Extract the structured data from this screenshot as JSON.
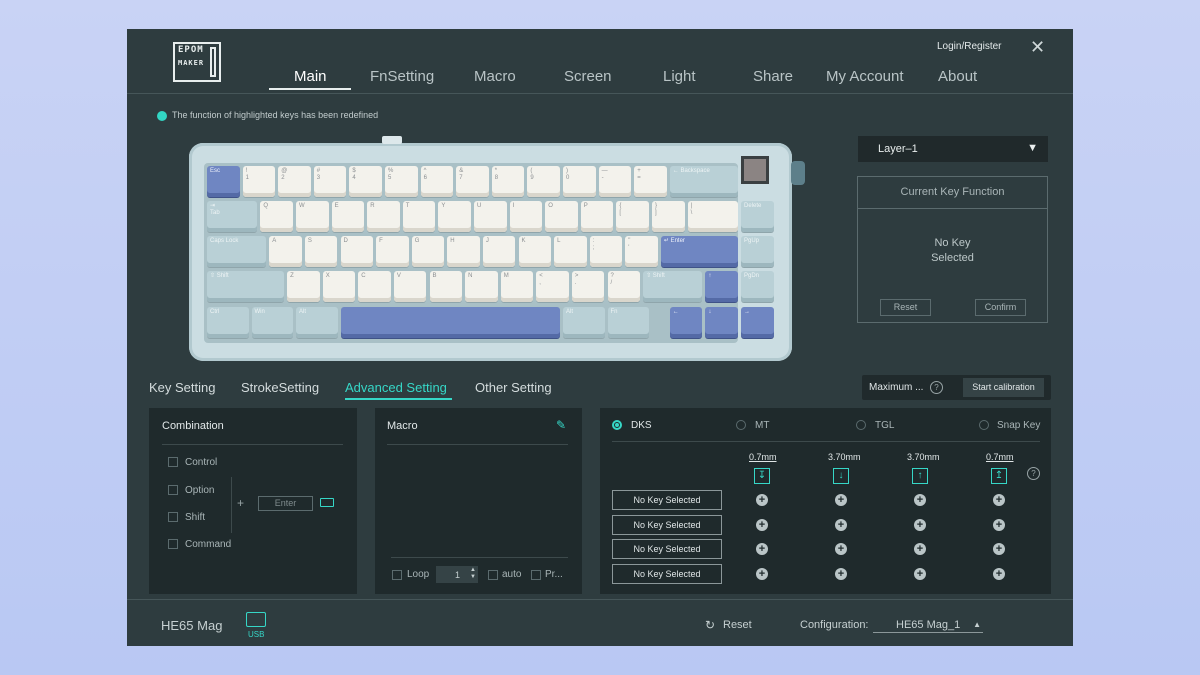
{
  "brand": {
    "line1": "EPOM",
    "line2": "MAKER"
  },
  "header": {
    "login": "Login/Register",
    "close": "✕"
  },
  "nav": [
    "Main",
    "FnSetting",
    "Macro",
    "Screen",
    "Light",
    "Share",
    "My Account",
    "About"
  ],
  "notice": "The function of highlighted keys has been redefined",
  "keyboard": {
    "row1": [
      "Esc",
      "!\n1",
      "@\n2",
      "#\n3",
      "$\n4",
      "%\n5",
      "^\n6",
      "&\n7",
      "*\n8",
      "(\n9",
      ")\n0",
      "—\n-",
      "+\n=",
      "← Backspace"
    ],
    "row2": [
      "⇥\nTab",
      "Q",
      "W",
      "E",
      "R",
      "T",
      "Y",
      "U",
      "I",
      "O",
      "P",
      "{\n[",
      "}\n]",
      "|\n\\",
      "Delete"
    ],
    "row3": [
      "Caps Lock",
      "A",
      "S",
      "D",
      "F",
      "G",
      "H",
      "J",
      "K",
      "L",
      ":\n;",
      "\"\n'",
      "↵ Enter",
      "PgUp"
    ],
    "row4": [
      "⇧ Shift",
      "Z",
      "X",
      "C",
      "V",
      "B",
      "N",
      "M",
      "<\n,",
      ">\n.",
      "?\n/",
      "⇧ Shift",
      "↑",
      "PgDn"
    ],
    "row5": [
      "Ctrl",
      "Win",
      "Alt",
      "",
      "Alt",
      "Fn",
      "←",
      "↓",
      "→"
    ]
  },
  "layer": {
    "label": "Layer–1",
    "arrow": "▼"
  },
  "key_function": {
    "title": "Current Key Function",
    "empty1": "No Key",
    "empty2": "Selected",
    "reset": "Reset",
    "confirm": "Confirm"
  },
  "tabs": [
    "Key Setting",
    "StrokeSetting",
    "Advanced Setting",
    "Other Setting"
  ],
  "calib": {
    "maximum": "Maximum ...",
    "help": "?",
    "start": "Start calibration"
  },
  "combination": {
    "title": "Combination",
    "options": [
      "Control",
      "Option",
      "Shift",
      "Command"
    ],
    "plus": "+",
    "key_placeholder": "Enter"
  },
  "macro": {
    "title": "Macro",
    "loop": "Loop",
    "loop_value": "1",
    "auto": "auto",
    "pr": "Pr..."
  },
  "dks": {
    "modes": [
      "DKS",
      "MT",
      "TGL",
      "Snap Key"
    ],
    "values": [
      "0.7mm",
      "3.70mm",
      "3.70mm",
      "0.7mm"
    ],
    "help": "?",
    "rows": [
      "No Key Selected",
      "No Key Selected",
      "No Key Selected",
      "No Key Selected"
    ]
  },
  "footer": {
    "device": "HE65 Mag",
    "usb": "USB",
    "reset": "Reset",
    "config_label": "Configuration:",
    "config_value": "HE65 Mag_1"
  }
}
